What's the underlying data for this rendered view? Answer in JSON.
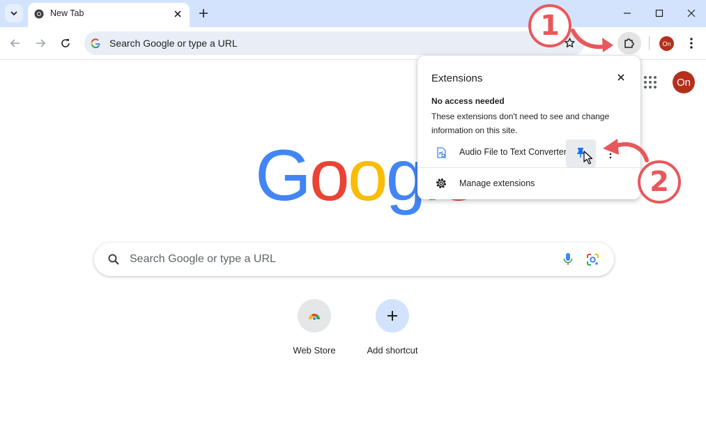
{
  "browser": {
    "tab": {
      "title": "New Tab"
    },
    "omnibox": {
      "placeholder": "Search Google or type a URL"
    },
    "profile_initials": "On"
  },
  "ntp": {
    "logo_text": "Google",
    "search": {
      "placeholder": "Search Google or type a URL"
    },
    "shortcuts": [
      {
        "label": "Web Store",
        "icon": "chrome-web-store-icon"
      },
      {
        "label": "Add shortcut",
        "icon": "plus-icon"
      }
    ]
  },
  "extensions_popup": {
    "title": "Extensions",
    "section_heading": "No access needed",
    "section_description": "These extensions don't need to see and change information on this site.",
    "extension_name": "Audio File to Text Converter",
    "manage_label": "Manage extensions"
  },
  "annotations": {
    "step1": "1",
    "step2": "2"
  },
  "colors": {
    "annotation": "#e8585a",
    "tab_strip": "#d3e3fd",
    "omnibox": "#e9eef6",
    "avatar": "#b5301b"
  }
}
